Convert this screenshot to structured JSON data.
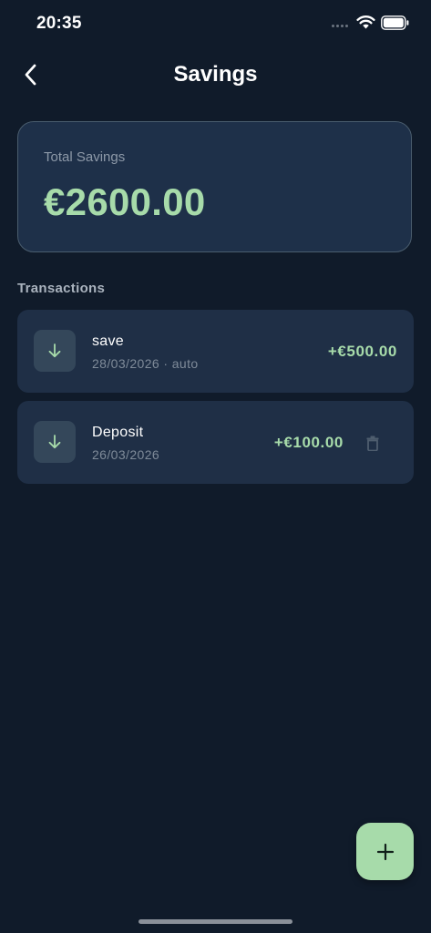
{
  "status_bar": {
    "time": "20:35"
  },
  "header": {
    "title": "Savings",
    "back_icon": "chevron-left-icon"
  },
  "summary": {
    "label": "Total Savings",
    "amount": "€2600.00"
  },
  "transactions_section": {
    "label": "Transactions",
    "items": [
      {
        "title": "save",
        "subtitle": "28/03/2026 · auto",
        "amount": "+€500.00",
        "icon": "arrow-down-icon",
        "deletable": false
      },
      {
        "title": "Deposit",
        "subtitle": "26/03/2026",
        "amount": "+€100.00",
        "icon": "arrow-down-icon",
        "deletable": true,
        "delete_icon": "trash-icon"
      }
    ]
  },
  "fab": {
    "icon": "plus-icon"
  },
  "colors": {
    "background": "#101b2a",
    "card": "#1f2f46",
    "accent": "#a7dbaa",
    "muted_text": "#7f8b99"
  }
}
